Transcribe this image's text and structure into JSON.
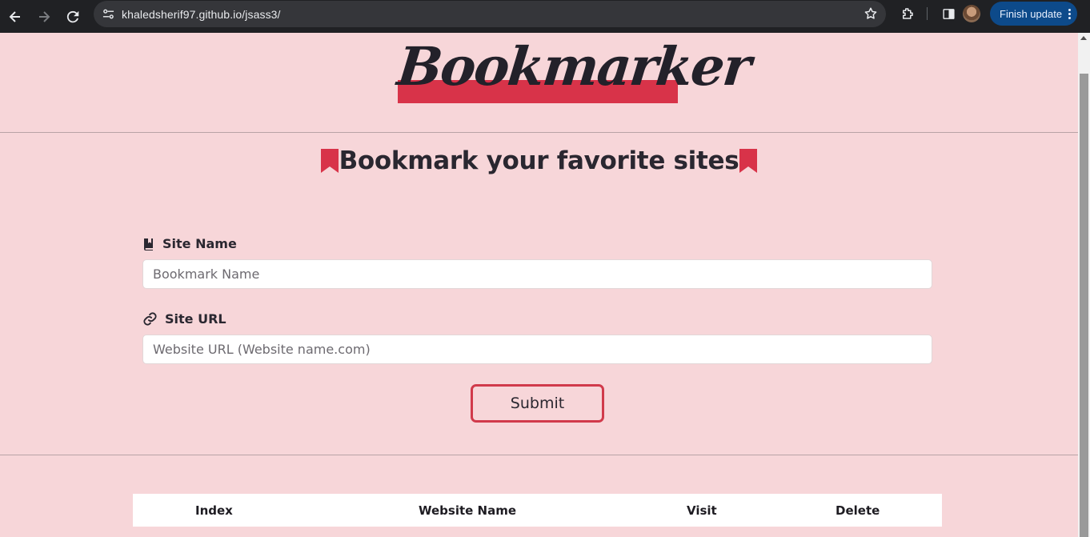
{
  "browser": {
    "url": "khaledsherif97.github.io/jsass3/",
    "update_label": "Finish update",
    "icons": [
      "back-icon",
      "forward-icon",
      "reload-icon",
      "site-info-icon",
      "star-icon",
      "extensions-icon",
      "side-panel-icon",
      "profile-avatar",
      "menu-icon"
    ]
  },
  "page": {
    "logo_text": "Bookmarker",
    "heading": "Bookmark your favorite sites",
    "form": {
      "name_label": "Site Name",
      "name_placeholder": "Bookmark Name",
      "url_label": "Site URL",
      "url_placeholder": "Website URL (Website name.com)",
      "submit_label": "Submit"
    },
    "table": {
      "headers": [
        "Index",
        "Website Name",
        "Visit",
        "Delete"
      ],
      "rows": []
    }
  },
  "colors": {
    "background": "#f7d6d9",
    "accent": "#d83349",
    "text": "#2a2730",
    "chrome": "#202124"
  }
}
